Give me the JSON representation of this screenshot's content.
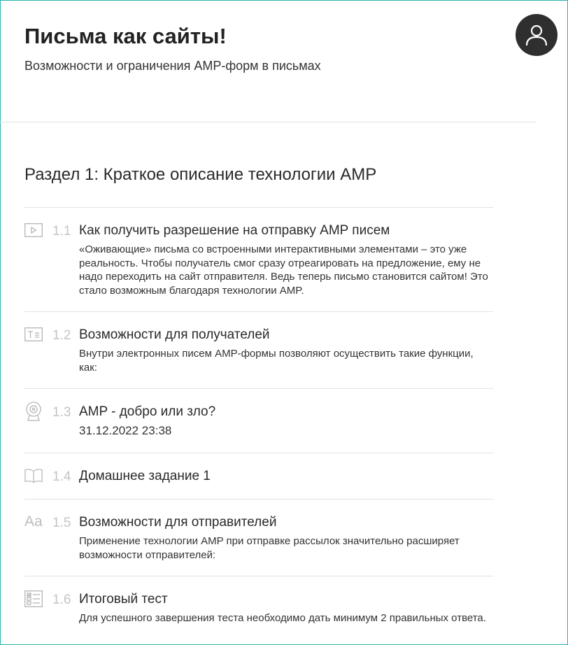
{
  "course": {
    "title": "Письма как сайты!",
    "subtitle": "Возможности и ограничения AMP-форм в письмах"
  },
  "user": {
    "icon": "user-icon"
  },
  "section": {
    "title": "Раздел 1: Краткое описание технологии AMP"
  },
  "lessons": [
    {
      "number": "1.1",
      "icon": "video-icon",
      "title": "Как получить разрешение на отправку AMP писем",
      "description": "«Оживающие» письма со встроенными интерактивными элементами – это уже реальность. Чтобы получатель смог сразу отреагировать на предложение, ему не надо переходить на сайт отправителя. Ведь теперь письмо становится сайтом! Это стало возможным благодаря технологии AMP."
    },
    {
      "number": "1.2",
      "icon": "text-lesson-icon",
      "title": "Возможности для получателей",
      "description": "Внутри электронных писем AMP-формы позволяют осуществить такие функции, как:"
    },
    {
      "number": "1.3",
      "icon": "webinar-camera-icon",
      "title": "AMP - добро или зло?",
      "date": "31.12.2022 23:38"
    },
    {
      "number": "1.4",
      "icon": "book-icon",
      "title": "Домашнее задание 1"
    },
    {
      "number": "1.5",
      "icon": "font-aa-icon",
      "title": "Возможности для отправителей",
      "description": "Применение технологии AMP при отправке рассылок значительно расширяет возможности отправителей:"
    },
    {
      "number": "1.6",
      "icon": "test-checklist-icon",
      "title": "Итоговый тест",
      "description": "Для успешного завершения теста необходимо дать минимум 2 правильных ответа."
    }
  ]
}
